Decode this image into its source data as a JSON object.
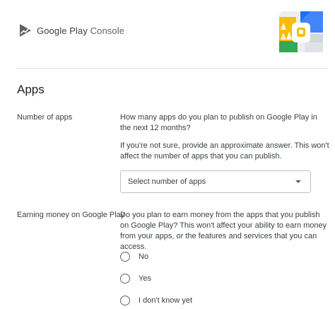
{
  "header": {
    "logo_brand": "Google Play",
    "logo_product": "Console"
  },
  "section_title": "Apps",
  "number_of_apps": {
    "label": "Number of apps",
    "question": "How many apps do you plan to publish on Google Play in the next 12 months?",
    "hint": "If you're not sure, provide an approximate answer. This won't affect the number of apps that you can publish.",
    "select_value": "Select number of apps"
  },
  "earning": {
    "label": "Earning money on Google Play",
    "question": "Do you plan to earn money from the apps that you publish on Google Play? This won't affect your ability to earn money from your apps, or the features and services that you can access.",
    "options": [
      {
        "label": "No"
      },
      {
        "label": "Yes"
      },
      {
        "label": "I don't know yet"
      }
    ]
  },
  "colors": {
    "play_blue": "#4285f4",
    "play_green": "#34a853",
    "play_yellow": "#fbbc04",
    "play_red": "#ea4335"
  }
}
